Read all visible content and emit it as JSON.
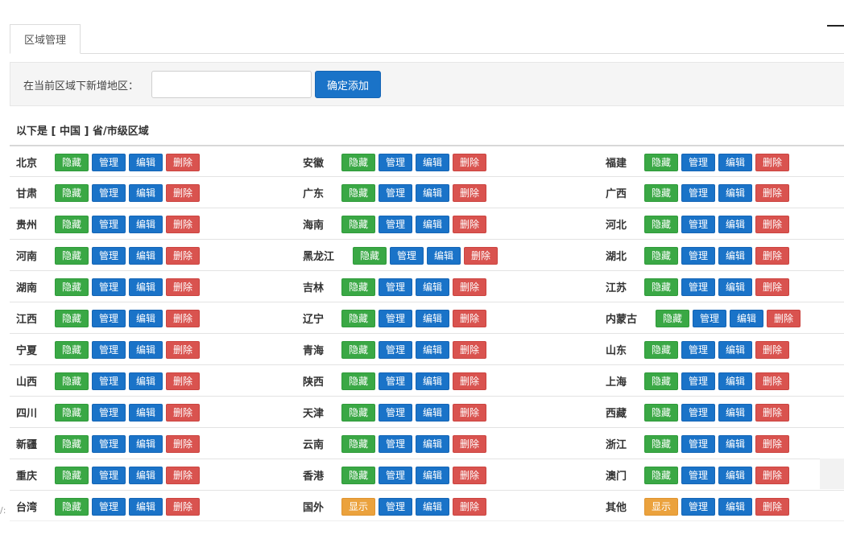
{
  "tab": {
    "label": "区域管理"
  },
  "add": {
    "label": "在当前区域下新增地区：",
    "input_value": "",
    "input_placeholder": "",
    "button_label": "确定添加"
  },
  "list_title": "以下是 [ 中国 ] 省/市级区域",
  "button_labels": {
    "hide": "隐藏",
    "show": "显示",
    "manage": "管理",
    "edit": "编辑",
    "delete": "删除"
  },
  "regions": [
    {
      "name": "北京",
      "visible": true
    },
    {
      "name": "安徽",
      "visible": true
    },
    {
      "name": "福建",
      "visible": true
    },
    {
      "name": "甘肃",
      "visible": true
    },
    {
      "name": "广东",
      "visible": true
    },
    {
      "name": "广西",
      "visible": true
    },
    {
      "name": "贵州",
      "visible": true
    },
    {
      "name": "海南",
      "visible": true
    },
    {
      "name": "河北",
      "visible": true
    },
    {
      "name": "河南",
      "visible": true
    },
    {
      "name": "黑龙江",
      "visible": true
    },
    {
      "name": "湖北",
      "visible": true
    },
    {
      "name": "湖南",
      "visible": true
    },
    {
      "name": "吉林",
      "visible": true
    },
    {
      "name": "江苏",
      "visible": true
    },
    {
      "name": "江西",
      "visible": true
    },
    {
      "name": "辽宁",
      "visible": true
    },
    {
      "name": "内蒙古",
      "visible": true
    },
    {
      "name": "宁夏",
      "visible": true
    },
    {
      "name": "青海",
      "visible": true
    },
    {
      "name": "山东",
      "visible": true
    },
    {
      "name": "山西",
      "visible": true
    },
    {
      "name": "陕西",
      "visible": true
    },
    {
      "name": "上海",
      "visible": true
    },
    {
      "name": "四川",
      "visible": true
    },
    {
      "name": "天津",
      "visible": true
    },
    {
      "name": "西藏",
      "visible": true
    },
    {
      "name": "新疆",
      "visible": true
    },
    {
      "name": "云南",
      "visible": true
    },
    {
      "name": "浙江",
      "visible": true
    },
    {
      "name": "重庆",
      "visible": true
    },
    {
      "name": "香港",
      "visible": true
    },
    {
      "name": "澳门",
      "visible": true
    },
    {
      "name": "台湾",
      "visible": true
    },
    {
      "name": "国外",
      "visible": false
    },
    {
      "name": "其他",
      "visible": false
    }
  ],
  "edge_text": "/:"
}
